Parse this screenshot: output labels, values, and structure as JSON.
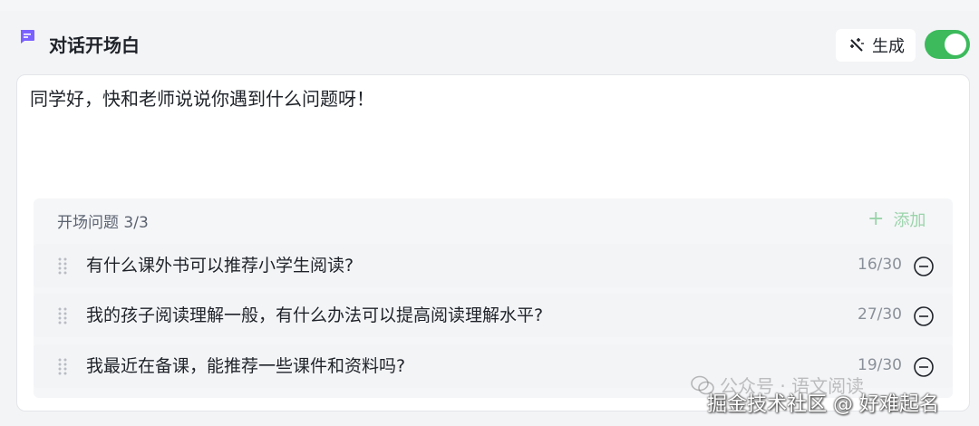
{
  "header": {
    "title": "对话开场白",
    "generate_label": "生成",
    "toggle_on": true,
    "accent_color": "#3cba5c",
    "title_icon_color": "#7b61ff"
  },
  "opening": {
    "text": "同学好，快和老师说说你遇到什么问题呀！"
  },
  "questions": {
    "header_label": "开场问题 3/3",
    "add_label": "添加",
    "items": [
      {
        "text": "有什么课外书可以推荐小学生阅读?",
        "count": "16/30"
      },
      {
        "text": "我的孩子阅读理解一般，有什么办法可以提高阅读理解水平?",
        "count": "27/30"
      },
      {
        "text": "我最近在备课，能推荐一些课件和资料吗?",
        "count": "19/30"
      }
    ]
  },
  "watermark": {
    "line1": "公众号 · 语文阅读",
    "line2": "掘金技术社区 @ 好难起名"
  }
}
